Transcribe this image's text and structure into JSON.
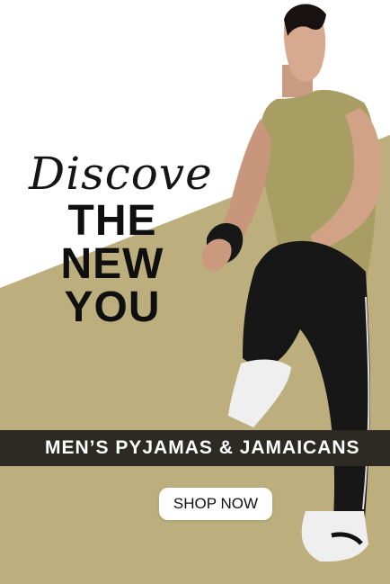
{
  "banner": {
    "script_word": "Discover",
    "headline_lines": [
      "THE",
      "NEW",
      "YOU"
    ],
    "strip_text": "MEN’S PYJAMAS & JAMAICANS",
    "cta_label": "SHOP NOW"
  },
  "colors": {
    "olive_background": "#bcaf7d",
    "strip": "#2d2a23",
    "text_dark": "#0f0f0f",
    "button": "#ffffff"
  },
  "images": {
    "model": "man-in-olive-tank-top-and-black-joggers"
  }
}
